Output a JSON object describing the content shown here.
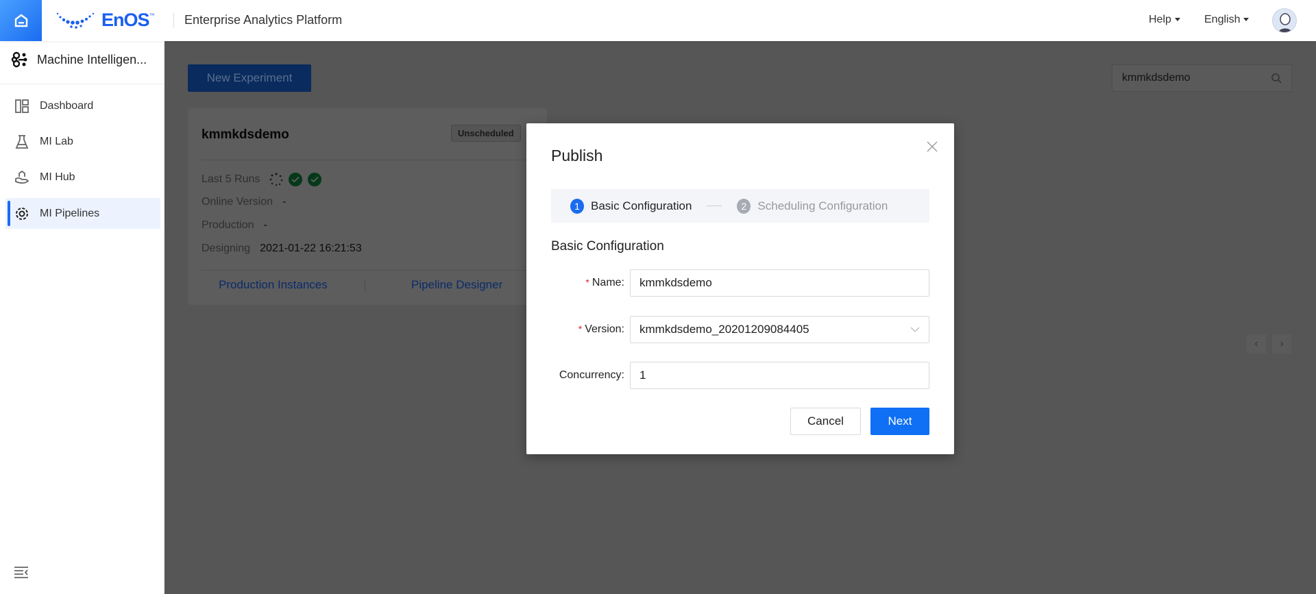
{
  "header": {
    "brand": "EnOS",
    "trademark": "™",
    "title": "Enterprise Analytics Platform",
    "help": "Help",
    "language": "English"
  },
  "sidebar": {
    "module": "Machine Intelligen...",
    "items": [
      {
        "label": "Dashboard",
        "icon": "dashboard-icon"
      },
      {
        "label": "MI Lab",
        "icon": "flask-icon"
      },
      {
        "label": "MI Hub",
        "icon": "hub-icon"
      },
      {
        "label": "MI Pipelines",
        "icon": "pipeline-icon",
        "active": true
      }
    ]
  },
  "main": {
    "new_button": "New Experiment",
    "search_value": "kmmkdsdemo",
    "card": {
      "title": "kmmkdsdemo",
      "status": "Unscheduled",
      "last_runs_label": "Last 5 Runs",
      "last_runs": [
        "running",
        "success",
        "success"
      ],
      "online_version_label": "Online Version",
      "online_version": "-",
      "production_label": "Production",
      "production": "-",
      "designing_label": "Designing",
      "designing": "2021-01-22 16:21:53",
      "link_instances": "Production Instances",
      "link_designer": "Pipeline Designer"
    }
  },
  "dialog": {
    "title": "Publish",
    "steps": [
      {
        "num": "1",
        "label": "Basic Configuration"
      },
      {
        "num": "2",
        "label": "Scheduling Configuration"
      }
    ],
    "section": "Basic Configuration",
    "fields": {
      "name_label": "Name:",
      "name_value": "kmmkdsdemo",
      "version_label": "Version:",
      "version_value": "kmmkdsdemo_20201209084405",
      "concurrency_label": "Concurrency:",
      "concurrency_value": "1"
    },
    "cancel": "Cancel",
    "next": "Next"
  },
  "colors": {
    "primary": "#1a6cf0",
    "success": "#12a04b",
    "required": "#e0242c"
  }
}
